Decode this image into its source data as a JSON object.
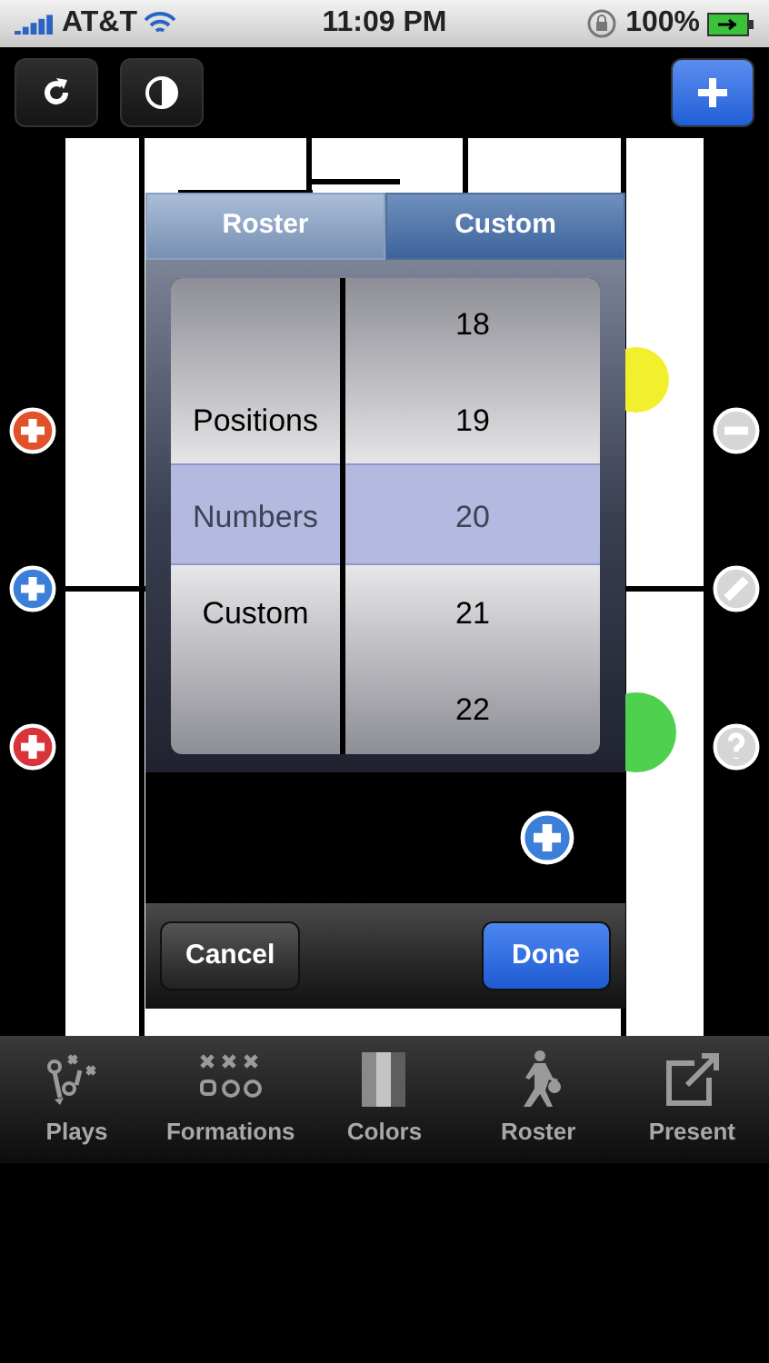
{
  "status_bar": {
    "carrier": "AT&T",
    "time": "11:09 PM",
    "battery": "100%"
  },
  "toolbar": {
    "buttons": [
      {
        "kind": "refresh"
      },
      {
        "kind": "contrast"
      },
      {
        "kind": "add"
      }
    ]
  },
  "side_controls": {
    "left": [
      {
        "kind": "add",
        "color": "#e0532a"
      },
      {
        "kind": "add",
        "color": "#3b7fd8"
      },
      {
        "kind": "add",
        "color": "#d9343a"
      }
    ],
    "right": [
      {
        "kind": "remove"
      },
      {
        "kind": "edit"
      },
      {
        "kind": "help"
      }
    ]
  },
  "tokens": [
    {
      "color": "#f2ef2c"
    },
    {
      "color": "#4fd150"
    }
  ],
  "picker_sheet": {
    "segments": [
      {
        "label": "Roster",
        "selected": false
      },
      {
        "label": "Custom",
        "selected": true
      }
    ],
    "columns": [
      {
        "items": [
          {
            "label": "Positions",
            "selected": false
          },
          {
            "label": "Numbers",
            "selected": true
          },
          {
            "label": "Custom",
            "selected": false
          }
        ]
      },
      {
        "items": [
          {
            "label": "18",
            "selected": false
          },
          {
            "label": "19",
            "selected": false
          },
          {
            "label": "20",
            "selected": true
          },
          {
            "label": "21",
            "selected": false
          },
          {
            "label": "22",
            "selected": false
          }
        ]
      }
    ],
    "cancel": "Cancel",
    "done": "Done"
  },
  "tab_bar": [
    {
      "kind": "plays",
      "label": "Plays"
    },
    {
      "kind": "formations",
      "label": "Formations"
    },
    {
      "kind": "colors",
      "label": "Colors"
    },
    {
      "kind": "roster",
      "label": "Roster"
    },
    {
      "kind": "present",
      "label": "Present"
    }
  ]
}
